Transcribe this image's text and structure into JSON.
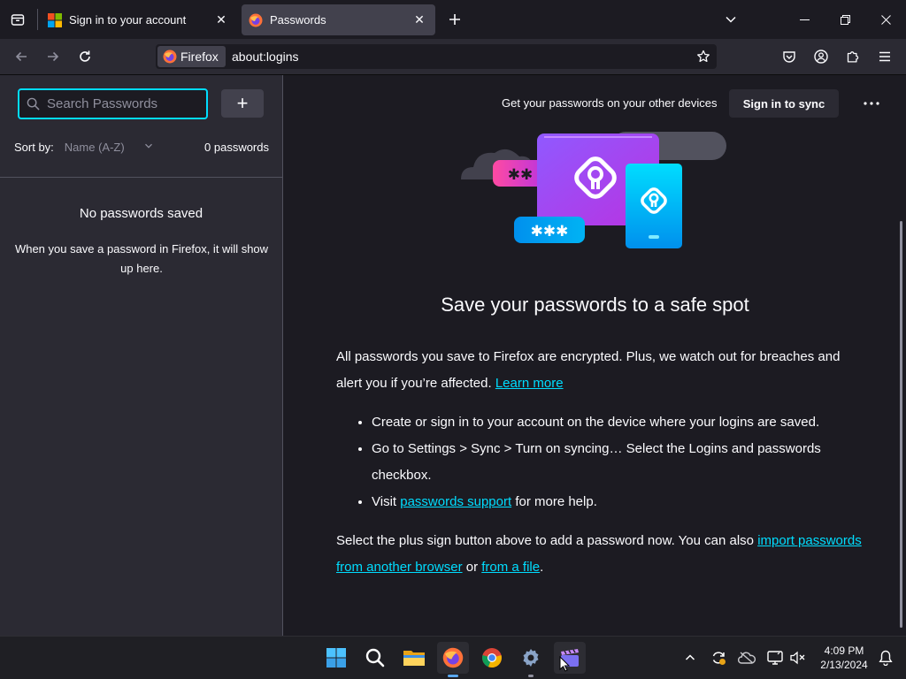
{
  "tabs": [
    {
      "title": "Sign in to your account"
    },
    {
      "title": "Passwords"
    }
  ],
  "urlbar": {
    "identity_label": "Firefox",
    "url": "about:logins"
  },
  "sidebar": {
    "search_placeholder": "Search Passwords",
    "add_label": "+",
    "sort_label": "Sort by:",
    "sort_value": "Name (A-Z)",
    "count": "0 passwords",
    "empty_title": "No passwords saved",
    "empty_desc": "When you save a password in Firefox, it will show up here."
  },
  "main": {
    "sync_text": "Get your passwords on your other devices",
    "sync_button": "Sign in to sync",
    "menu_label": "···",
    "heading": "Save your passwords to a safe spot",
    "intro_text": "All passwords you save to Firefox are encrypted. Plus, we watch out for breaches and alert you if you’re affected.",
    "learn_more": "Learn more",
    "bullets": [
      "Create or sign in to your account on the device where your logins are saved.",
      "Go to Settings > Sync > Turn on syncing… Select the Logins and passwords checkbox."
    ],
    "visit_prefix": "Visit",
    "support_link": "passwords support",
    "visit_suffix": "for more help.",
    "import_prefix": "Select the plus sign button above to add a password now. You can also",
    "import_link": "import passwords from another browser",
    "import_or": "or",
    "file_link": "from a file",
    "import_end": ".",
    "illustration_stars_a": "✱✱",
    "illustration_stars_b": "✱✱✱"
  },
  "taskbar": {
    "time": "4:09 PM",
    "date": "2/13/2024"
  },
  "colors": {
    "accent": "#00ddff",
    "tab_active": "#42414d",
    "toolbar": "#2b2a33",
    "background": "#1c1b22"
  }
}
